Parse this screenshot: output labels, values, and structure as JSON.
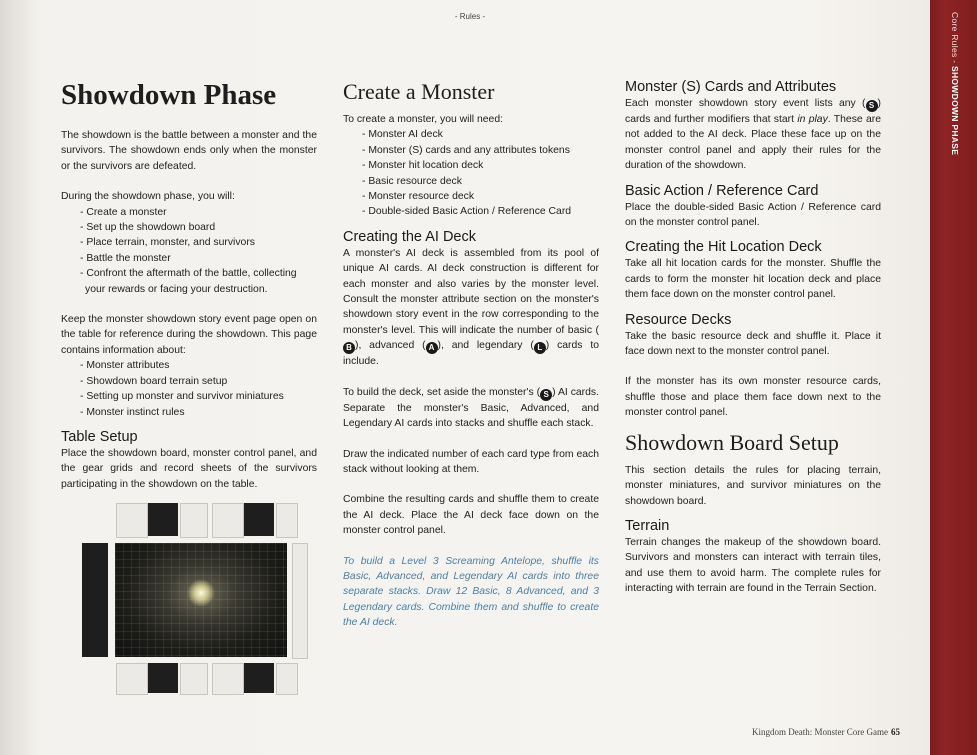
{
  "header": "- Rules -",
  "side_tab": {
    "section": "Core Rules - ",
    "phase": "SHOWDOWN PHASE"
  },
  "footer": {
    "book": "Kingdom Death: Monster Core Game",
    "page": "65"
  },
  "col1": {
    "title": "Showdown Phase",
    "intro": "The showdown is the battle between a monster and the survivors. The showdown ends only when the monster or the survivors are defeated.",
    "during_lead": "During the showdown phase, you will:",
    "during_items": [
      "- Create a monster",
      "- Set up the showdown board",
      "- Place terrain, monster, and survivors",
      "- Battle the monster",
      "- Confront the aftermath of the battle, collecting your rewards or facing your destruction."
    ],
    "keep_text": "Keep the monster showdown story event page open on the table for reference during the showdown. This page contains information about:",
    "keep_items": [
      "- Monster attributes",
      "- Showdown board terrain setup",
      "- Setting up monster and survivor miniatures",
      "- Monster instinct rules"
    ],
    "table_setup_title": "Table Setup",
    "table_setup_text": "Place the showdown board, monster control panel, and the gear grids and record sheets of the survivors participating in the showdown on the table."
  },
  "col2": {
    "title": "Create a Monster",
    "need_lead": "To create a monster, you will need:",
    "need_items": [
      "- Monster AI deck",
      "- Monster (S) cards and any attributes tokens",
      "- Monster hit location deck",
      "- Basic resource deck",
      "- Monster resource deck",
      "- Double-sided Basic Action / Reference Card"
    ],
    "ai_title": "Creating the AI Deck",
    "ai_text_1": "A monster's AI deck is assembled from its pool of unique AI cards. AI deck construction is different for each monster and also varies by the monster level. Consult the monster attribute section on the monster's showdown story event in the row corresponding to the monster's level. This will indicate the number of basic (",
    "ai_badge_b": "B",
    "ai_text_2": "), advanced (",
    "ai_badge_a": "A",
    "ai_text_3": "), and legendary (",
    "ai_badge_l": "L",
    "ai_text_4": ") cards to include.",
    "build_text_1": "To build the deck, set aside the monster's (",
    "build_badge_s": "S",
    "build_text_2": ") AI cards. Separate the monster's Basic, Advanced, and Legendary AI cards into stacks and shuffle each stack.",
    "draw_text": "Draw the indicated number of each card type from each stack without looking at them.",
    "combine_text": "Combine the resulting cards and shuffle them to create the AI deck. Place the AI deck face down on the monster control panel.",
    "example_text": "To build a Level 3 Screaming Antelope, shuffle its Basic, Advanced, and Legendary AI cards into three separate stacks. Draw 12 Basic, 8 Advanced, and 3 Legendary cards. Combine them and shuffle to create the AI deck."
  },
  "col3": {
    "s_title": "Monster (S) Cards and Attributes",
    "s_text_1": "Each monster showdown story event lists any (",
    "s_badge": "S",
    "s_text_2": ") cards and further modifiers that start ",
    "s_text_em": "in play",
    "s_text_3": ". These are not added to the AI deck. Place these face up on the monster control panel and apply their rules for the duration of the showdown.",
    "basic_title": "Basic Action / Reference Card",
    "basic_text": "Place the double-sided Basic Action / Reference card on the monster control panel.",
    "hit_title": "Creating the Hit Location Deck",
    "hit_text": "Take all hit location cards for the monster. Shuffle the cards to form the monster hit location deck and place them face down on the monster control panel.",
    "res_title": "Resource Decks",
    "res_text_1": "Take the basic resource deck and shuffle it. Place it face down next to the monster control panel.",
    "res_text_2": "If the monster has its own monster resource cards, shuffle those and place them face down next to the monster control panel.",
    "board_title": "Showdown Board Setup",
    "board_text": "This section details the rules for placing terrain, monster miniatures, and survivor miniatures on the showdown board.",
    "terrain_title": "Terrain",
    "terrain_text": "Terrain changes the makeup of the showdown board. Survivors and monsters can interact with terrain tiles, and use them to avoid harm. The complete rules for interacting with terrain are found in the Terrain Section."
  }
}
